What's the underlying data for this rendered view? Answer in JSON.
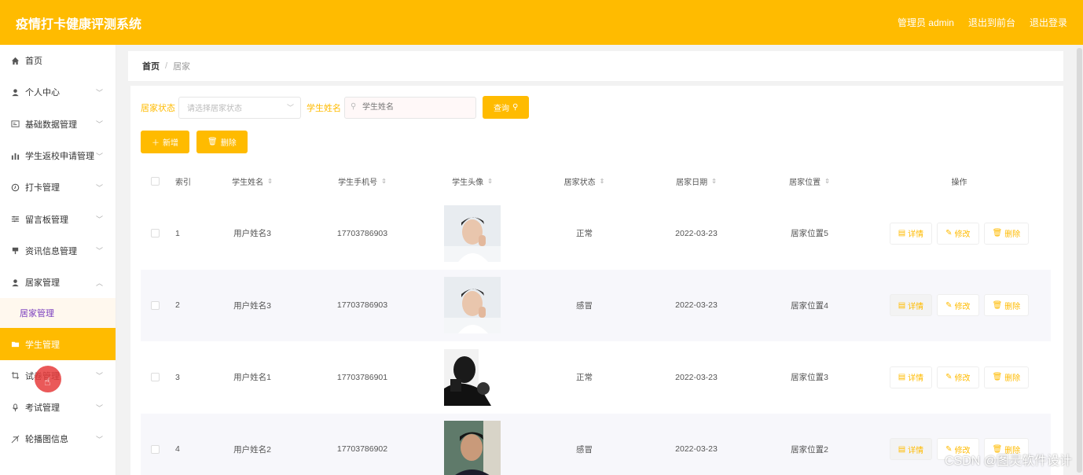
{
  "header": {
    "title": "疫情打卡健康评测系统",
    "user_label": "管理员 admin",
    "back_frontend": "退出到前台",
    "logout": "退出登录"
  },
  "sidebar": {
    "items": [
      {
        "label": "首页",
        "icon": "home-icon",
        "has_chevron": false
      },
      {
        "label": "个人中心",
        "icon": "person-icon",
        "has_chevron": true
      },
      {
        "label": "基础数据管理",
        "icon": "card-icon",
        "has_chevron": true
      },
      {
        "label": "学生返校申请管理",
        "icon": "bar-chart-icon",
        "has_chevron": true
      },
      {
        "label": "打卡管理",
        "icon": "clock-icon",
        "has_chevron": true
      },
      {
        "label": "留言板管理",
        "icon": "sliders-icon",
        "has_chevron": true
      },
      {
        "label": "资讯信息管理",
        "icon": "pin-icon",
        "has_chevron": true
      },
      {
        "label": "居家管理",
        "icon": "person-icon",
        "has_chevron": true,
        "expanded": true
      }
    ],
    "submenu": {
      "label": "居家管理"
    },
    "items_after": [
      {
        "label": "学生管理",
        "icon": "folder-icon",
        "active": true
      },
      {
        "label": "试卷管理",
        "icon": "crop-icon",
        "has_chevron": true
      },
      {
        "label": "考试管理",
        "icon": "mic-icon",
        "has_chevron": true
      },
      {
        "label": "轮播图信息",
        "icon": "tag-icon",
        "has_chevron": true
      }
    ]
  },
  "breadcrumb": {
    "home": "首页",
    "separator": "/",
    "current": "居家"
  },
  "filters": {
    "status_label": "居家状态",
    "status_placeholder": "请选择居家状态",
    "name_label": "学生姓名",
    "name_placeholder": "学生姓名",
    "query_button": "查询"
  },
  "toolbar": {
    "add_button": "新增",
    "delete_button": "删除"
  },
  "table": {
    "columns": [
      "索引",
      "学生姓名",
      "学生手机号",
      "学生头像",
      "居家状态",
      "居家日期",
      "居家位置",
      "操作"
    ],
    "rows": [
      {
        "index": "1",
        "name": "用户姓名3",
        "phone": "17703786903",
        "status": "正常",
        "date": "2022-03-23",
        "location": "居家位置5",
        "avatar": "light"
      },
      {
        "index": "2",
        "name": "用户姓名3",
        "phone": "17703786903",
        "status": "感冒",
        "date": "2022-03-23",
        "location": "居家位置4",
        "avatar": "light"
      },
      {
        "index": "3",
        "name": "用户姓名1",
        "phone": "17703786901",
        "status": "正常",
        "date": "2022-03-23",
        "location": "居家位置3",
        "avatar": "bw"
      },
      {
        "index": "4",
        "name": "用户姓名2",
        "phone": "17703786902",
        "status": "感冒",
        "date": "2022-03-23",
        "location": "居家位置2",
        "avatar": "dark"
      }
    ],
    "row_actions": {
      "detail": "详情",
      "edit": "修改",
      "delete": "删除"
    }
  },
  "watermark": "CSDN @图灵软件设计",
  "colors": {
    "accent": "#FFBB00",
    "submenu_text": "#7b3fbf"
  }
}
